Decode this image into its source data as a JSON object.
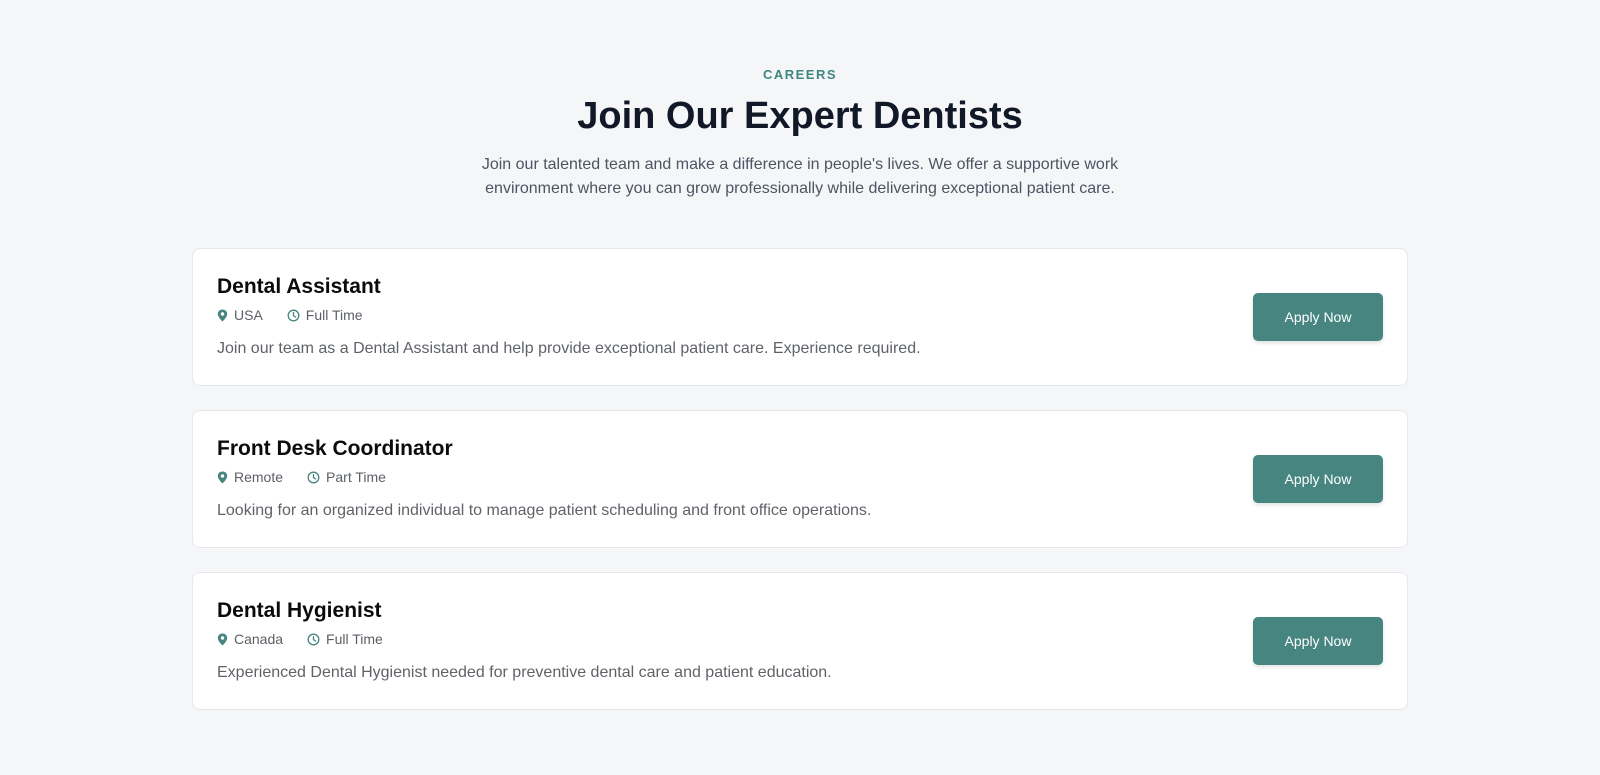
{
  "header": {
    "eyebrow": "CAREERS",
    "title": "Join Our Expert Dentists",
    "subtitle": "Join our talented team and make a difference in people's lives. We offer a supportive work environment where you can grow professionally while delivering exceptional patient care."
  },
  "colors": {
    "accent": "#468580",
    "eyebrow": "#3f8580",
    "background": "#f5f6f8"
  },
  "jobs": [
    {
      "title": "Dental Assistant",
      "location": "USA",
      "type": "Full Time",
      "description": "Join our team as a Dental Assistant and help provide exceptional patient care. Experience required.",
      "button_label": "Apply Now",
      "location_icon": "map-pin-icon",
      "type_icon": "clock-icon"
    },
    {
      "title": "Front Desk Coordinator",
      "location": "Remote",
      "type": "Part Time",
      "description": "Looking for an organized individual to manage patient scheduling and front office operations.",
      "button_label": "Apply Now",
      "location_icon": "map-pin-icon",
      "type_icon": "clock-icon"
    },
    {
      "title": "Dental Hygienist",
      "location": "Canada",
      "type": "Full Time",
      "description": "Experienced Dental Hygienist needed for preventive dental care and patient education.",
      "button_label": "Apply Now",
      "location_icon": "map-pin-icon",
      "type_icon": "clock-icon"
    }
  ]
}
